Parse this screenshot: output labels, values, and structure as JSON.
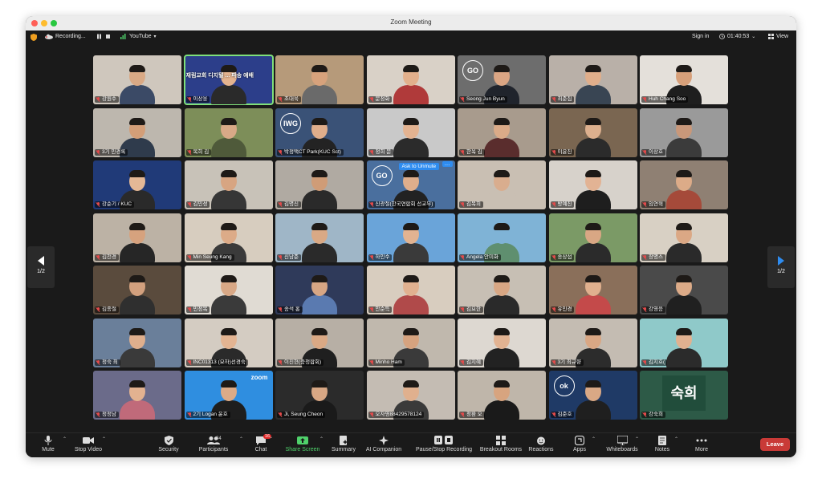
{
  "window": {
    "title": "Zoom Meeting"
  },
  "topbar": {
    "recording_label": "Recording...",
    "youtube_label": "YouTube",
    "signin_label": "Sign in",
    "timer": "01:40:53",
    "view_label": "View"
  },
  "pagination": {
    "left": "1/2",
    "right": "1/2"
  },
  "participants": [
    {
      "name": "강원수",
      "bg": "#cfc7bd",
      "skin": "#d9a985",
      "shirt": "#3b4a66"
    },
    {
      "name": "이상웅",
      "bg": "#2c3e8a",
      "skin": "#e3b38f",
      "shirt": "#2a2a2a",
      "active": true,
      "banner": "재림교회 디지털 ... 파송 예배"
    },
    {
      "name": "조대욱",
      "bg": "#b69a7a",
      "skin": "#d7a27c",
      "shirt": "#6a6a6a"
    },
    {
      "name": "문정화",
      "bg": "#d9d1c7",
      "skin": "#e2b08c",
      "shirt": "#b03a3a"
    },
    {
      "name": "Seong Jun Byun",
      "bg": "#6d6d6d",
      "skin": "#dba684",
      "shirt": "#20242c",
      "logo": "GO"
    },
    {
      "name": "최준집",
      "bg": "#b9b0a8",
      "skin": "#e0ae8b",
      "shirt": "#394553"
    },
    {
      "name": "Huh Chang Soo",
      "bg": "#e4e0da",
      "skin": "#d7a07a",
      "shirt": "#1e1e1e"
    },
    {
      "name": "3기 민경록",
      "bg": "#bdb7ae",
      "skin": "#d39e78",
      "shirt": "#2f3b4c"
    },
    {
      "name": "복희 김",
      "bg": "#7d8e59",
      "skin": "#d8a987",
      "shirt": "#4f5a3a"
    },
    {
      "name": "박정택CT Park(KUC Sct)",
      "bg": "#3a5277",
      "skin": "#e0ae8b",
      "shirt": "#232323",
      "logo": "IWG"
    },
    {
      "name": "정희 문",
      "bg": "#c9c9c9",
      "skin": "#e3b391",
      "shirt": "#2b2b2b"
    },
    {
      "name": "한옥 김",
      "bg": "#a89b8d",
      "skin": "#dbab88",
      "shirt": "#5a2d2d"
    },
    {
      "name": "이윤진",
      "bg": "#7a6651",
      "skin": "#ddb08e",
      "shirt": "#2b2b2b"
    },
    {
      "name": "이상호",
      "bg": "#9a9a9a",
      "skin": "#c9987a",
      "shirt": "#3b3b3b"
    },
    {
      "name": "강순기 / KUC",
      "bg": "#203a78",
      "skin": "#e4b896",
      "shirt": "#2a2a2a"
    },
    {
      "name": "김민성",
      "bg": "#c8c2b8",
      "skin": "#d7a582",
      "shirt": "#363636"
    },
    {
      "name": "김명신",
      "bg": "#b0aaa2",
      "skin": "#cf9c77",
      "shirt": "#2a2a2a"
    },
    {
      "name": "신광철(한국연합회 선교부)",
      "bg": "#4a6f9e",
      "skin": "#dfae8c",
      "shirt": "#222222",
      "logo": "GO",
      "unmute": "Ask to Unmute"
    },
    {
      "name": "김복희",
      "bg": "#c9bfb3",
      "skin": "#d9ad8e",
      "shirt": "#c9bfb3"
    },
    {
      "name": "방예진",
      "bg": "#d7d2cb",
      "skin": "#e2b394",
      "shirt": "#1e1e1e"
    },
    {
      "name": "임연혁",
      "bg": "#8f8073",
      "skin": "#dcab88",
      "shirt": "#a54a3a"
    },
    {
      "name": "김천경",
      "bg": "#bcb2a5",
      "skin": "#d6a27e",
      "shirt": "#262626"
    },
    {
      "name": "Min Seung Kang",
      "bg": "#d7cdbf",
      "skin": "#dcab88",
      "shirt": "#3a3a3a"
    },
    {
      "name": "신남준",
      "bg": "#9fb6c7",
      "skin": "#d9a985",
      "shirt": "#2a2a2a"
    },
    {
      "name": "하인수",
      "bg": "#6aa4d9",
      "skin": "#e2b391",
      "shirt": "#3a3a3a"
    },
    {
      "name": "Angela 안미화",
      "bg": "#7fb3d6",
      "skin": "#7fb3d6",
      "shirt": "#5f8f6f"
    },
    {
      "name": "송상섭",
      "bg": "#7b9a66",
      "skin": "#d9a784",
      "shirt": "#2b2b2b"
    },
    {
      "name": "장명스",
      "bg": "#d8d0c4",
      "skin": "#dba885",
      "shirt": "#2a2a2a"
    },
    {
      "name": "김종철",
      "bg": "#5a4b3d",
      "skin": "#d2a07e",
      "shirt": "#2f2f2f"
    },
    {
      "name": "민정복",
      "bg": "#e0dbd3",
      "skin": "#d8a886",
      "shirt": "#3a3a3a"
    },
    {
      "name": "송석 홍",
      "bg": "#2f3a5a",
      "skin": "#d7a684",
      "shirt": "#5a7ab0"
    },
    {
      "name": "안순득",
      "bg": "#d8cdbf",
      "skin": "#e1b190",
      "shirt": "#b04a4a"
    },
    {
      "name": "김요한",
      "bg": "#c7bfb4",
      "skin": "#d8a784",
      "shirt": "#2a2a2a"
    },
    {
      "name": "유인경",
      "bg": "#8a6f5a",
      "skin": "#e0b08e",
      "shirt": "#c44a4a"
    },
    {
      "name": "강영응",
      "bg": "#4a4a4a",
      "skin": "#dcab88",
      "shirt": "#202020"
    },
    {
      "name": "정숙 최",
      "bg": "#6a7f9a",
      "skin": "#dfaf8d",
      "shirt": "#3a3a3a"
    },
    {
      "name": "INC01313 (요하)선경숙",
      "bg": "#d4ccc2",
      "skin": "#e3b492",
      "shirt": "#2a2a2a"
    },
    {
      "name": "이진현(충청합회)",
      "bg": "#b7afa5",
      "skin": "#daa985",
      "shirt": "#1f1f1f"
    },
    {
      "name": "Minho Ham",
      "bg": "#c0b8ad",
      "skin": "#d6a37f",
      "shirt": "#3a3a3a"
    },
    {
      "name": "김지혜",
      "bg": "#ddd8d1",
      "skin": "#e2b392",
      "shirt": "#222222"
    },
    {
      "name": "3기 최규향",
      "bg": "#c4bcb2",
      "skin": "#d9a784",
      "shirt": "#2c2c2c"
    },
    {
      "name": "김지호(",
      "bg": "#8fc9c9",
      "skin": "#e1b190",
      "shirt": "#2b2b2b"
    },
    {
      "name": "정정남",
      "bg": "#6b6b8a",
      "skin": "#e2b290",
      "shirt": "#c06a7a"
    },
    {
      "name": "2기 Logan 윤호",
      "bg": "#2f8ee0",
      "skin": "#dcab88",
      "shirt": "#1e1e1e",
      "logo": "zoom"
    },
    {
      "name": "Ji, Seung Cheon",
      "bg": "#2b2b2b",
      "skin": "#d8a784",
      "shirt": "#1a1a1a"
    },
    {
      "name": "오자영88429578124",
      "bg": "#c4bcb3",
      "skin": "#e0b08e",
      "shirt": "#3a3a3a"
    },
    {
      "name": "정환 오",
      "bg": "#bfb6aa",
      "skin": "#d7a47f",
      "shirt": "#1a1a1a"
    },
    {
      "name": "김준호",
      "bg": "#1f3a66",
      "skin": "#d9a885",
      "shirt": "#1f1f1f",
      "logo": "ok"
    },
    {
      "name": "강숙희",
      "bg": "#2d5a47",
      "skin": "#2d5a47",
      "shirt": "#2d5a47",
      "text_avatar": "숙희"
    }
  ],
  "toolbar": {
    "mute": "Mute",
    "stop_video": "Stop Video",
    "security": "Security",
    "participants": "Participants",
    "participants_count": "94",
    "chat": "Chat",
    "chat_badge": "16",
    "share_screen": "Share Screen",
    "summary": "Summary",
    "ai_companion": "AI Companion",
    "pause_stop_recording": "Pause/Stop Recording",
    "breakout_rooms": "Breakout Rooms",
    "reactions": "Reactions",
    "apps": "Apps",
    "whiteboards": "Whiteboards",
    "notes": "Notes",
    "more": "More",
    "leave": "Leave"
  },
  "colors": {
    "share_green": "#4fd16b",
    "leave_red": "#c93a37",
    "active_border": "#7fe07a",
    "mic_muted": "#e24b4b"
  }
}
